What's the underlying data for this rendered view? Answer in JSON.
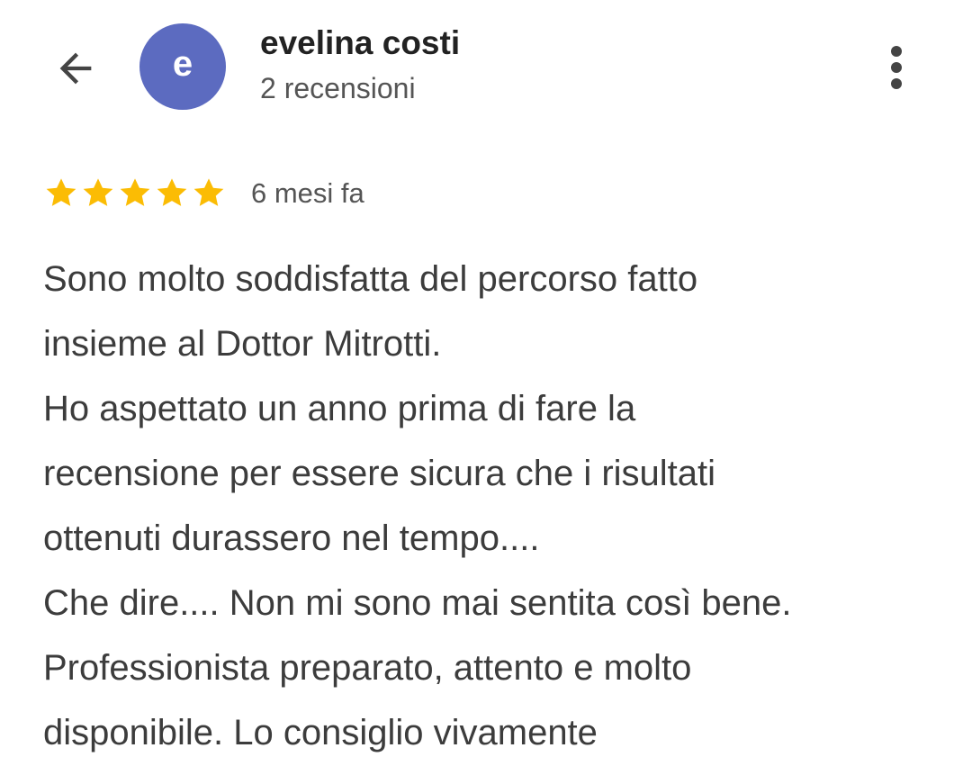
{
  "header": {
    "back_icon": "arrow-left-icon",
    "avatar_letter": "e",
    "avatar_color": "#5c6bc0",
    "user_name": "evelina costi",
    "review_count": "2 recensioni",
    "more_icon": "more-vertical-icon"
  },
  "review": {
    "rating": 5,
    "rating_max": 5,
    "star_color": "#fbbc04",
    "date": "6 mesi fa",
    "lines": [
      "Sono molto soddisfatta del percorso fatto",
      "insieme al Dottor Mitrotti.",
      "Ho aspettato un anno prima di fare la",
      "recensione per essere sicura che i risultati",
      "ottenuti durassero nel tempo....",
      "Che dire.... Non mi sono mai sentita così bene.",
      "Professionista preparato, attento e molto",
      "disponibile. Lo consiglio vivamente"
    ]
  }
}
